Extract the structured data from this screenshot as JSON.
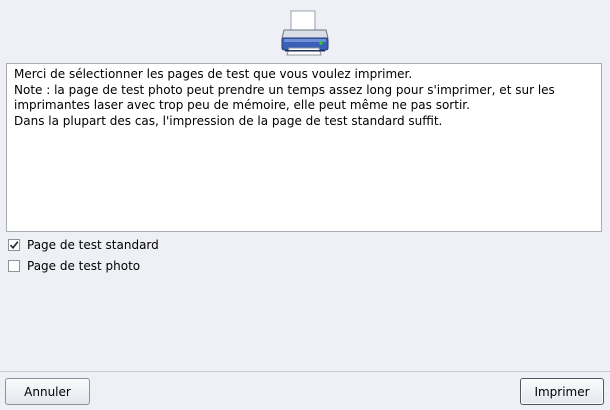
{
  "message": {
    "text": "Merci de sélectionner les pages de test que vous voulez imprimer.\nNote : la page de test photo peut prendre un temps assez long pour s'imprimer, et sur les imprimantes laser avec trop peu de mémoire, elle peut même ne pas sortir.\nDans la plupart des cas, l'impression de la page de test standard suffit."
  },
  "options": {
    "standard": {
      "label": "Page de test standard",
      "checked": true
    },
    "photo": {
      "label": "Page de test photo",
      "checked": false
    }
  },
  "buttons": {
    "cancel_label": "Annuler",
    "print_label": "Imprimer"
  },
  "icons": {
    "header": "printer-icon"
  },
  "colors": {
    "window_bg": "#eef0f5",
    "printer_body": "#3b5fb8",
    "led": "#35c42f"
  }
}
